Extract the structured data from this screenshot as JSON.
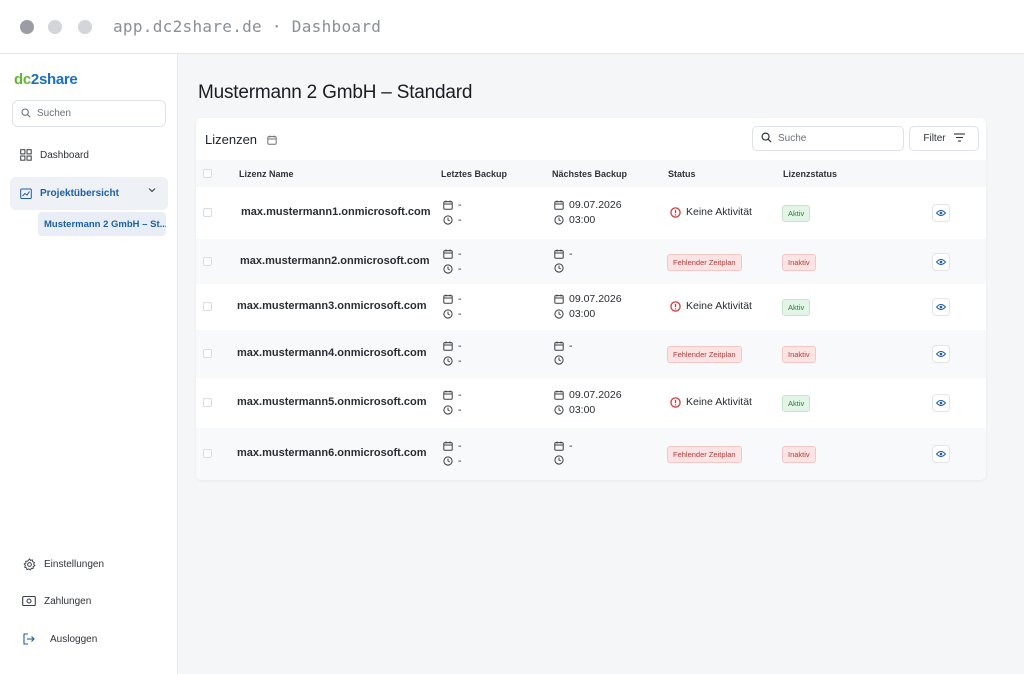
{
  "browser": {
    "url": "app.dc2share.de · Dashboard"
  },
  "sidebar": {
    "logo_part1": "dc",
    "logo_part2": "2share",
    "search_placeholder": "Suchen",
    "nav": {
      "dashboard": "Dashboard",
      "projects": "Projektübersicht",
      "project_sub": "Mustermann 2 GmbH – St..."
    },
    "bottom": {
      "settings": "Einstellungen",
      "payments": "Zahlungen",
      "logout": "Ausloggen"
    }
  },
  "main": {
    "page_title": "Mustermann 2 GmbH – Standard",
    "card_title": "Lizenzen",
    "search_placeholder": "Suche",
    "filter_label": "Filter",
    "columns": {
      "name": "Lizenz Name",
      "last_backup": "Letztes Backup",
      "next_backup": "Nächstes Backup",
      "status": "Status",
      "license_status": "Lizenzstatus"
    },
    "rows": [
      {
        "name": "max.mustermann1.onmicrosoft.com",
        "last_date": "-",
        "last_time": "-",
        "next_date": "09.07.2026",
        "next_time": "03:00",
        "status": "Keine Aktivität",
        "license": "Aktiv"
      },
      {
        "name": "max.mustermann2.onmicrosoft.com",
        "last_date": "-",
        "last_time": "-",
        "next_date": "-",
        "next_time": "",
        "status": "Fehlender Zeitplan",
        "license": "Inaktiv"
      },
      {
        "name": "max.mustermann3.onmicrosoft.com",
        "last_date": "-",
        "last_time": "-",
        "next_date": "09.07.2026",
        "next_time": "03:00",
        "status": "Keine Aktivität",
        "license": "Aktiv"
      },
      {
        "name": "max.mustermann4.onmicrosoft.com",
        "last_date": "-",
        "last_time": "-",
        "next_date": "-",
        "next_time": "",
        "status": "Fehlender Zeitplan",
        "license": "Inaktiv"
      },
      {
        "name": "max.mustermann5.onmicrosoft.com",
        "last_date": "-",
        "last_time": "-",
        "next_date": "09.07.2026",
        "next_time": "03:00",
        "status": "Keine Aktivität",
        "license": "Aktiv"
      },
      {
        "name": "max.mustermann6.onmicrosoft.com",
        "last_date": "-",
        "last_time": "-",
        "next_date": "-",
        "next_time": "",
        "status": "Fehlender Zeitplan",
        "license": "Inaktiv"
      }
    ]
  },
  "colors": {
    "accent_blue": "#1d5fa6",
    "logo_green": "#5fb830",
    "error_red": "#d23b3b",
    "badge_green_bg": "#e3f5e6",
    "badge_red_bg": "#fde4e4"
  },
  "icons": {
    "search": "search-icon",
    "dashboard": "dashboard-grid-icon",
    "projects": "folder-chart-icon",
    "chevron": "chevron-down-icon",
    "settings": "gear-icon",
    "payments": "money-icon",
    "logout": "logout-icon",
    "calendar": "calendar-icon",
    "clock": "clock-icon",
    "error": "alert-circle-icon",
    "eye": "eye-icon",
    "filter": "filter-lines-icon"
  }
}
